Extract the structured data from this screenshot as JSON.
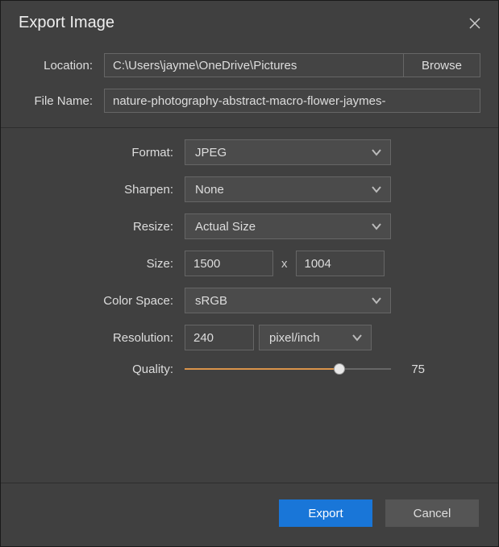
{
  "dialog": {
    "title": "Export Image"
  },
  "location": {
    "label": "Location:",
    "value": "C:\\Users\\jayme\\OneDrive\\Pictures",
    "browse": "Browse"
  },
  "filename": {
    "label": "File Name:",
    "value": "nature-photography-abstract-macro-flower-jaymes-"
  },
  "format": {
    "label": "Format:",
    "value": "JPEG"
  },
  "sharpen": {
    "label": "Sharpen:",
    "value": "None"
  },
  "resize": {
    "label": "Resize:",
    "value": "Actual Size"
  },
  "size": {
    "label": "Size:",
    "width": "1500",
    "x": "x",
    "height": "1004"
  },
  "colorspace": {
    "label": "Color Space:",
    "value": "sRGB"
  },
  "resolution": {
    "label": "Resolution:",
    "value": "240",
    "unit": "pixel/inch"
  },
  "quality": {
    "label": "Quality:",
    "value": "75",
    "percent": 75
  },
  "footer": {
    "export": "Export",
    "cancel": "Cancel"
  }
}
